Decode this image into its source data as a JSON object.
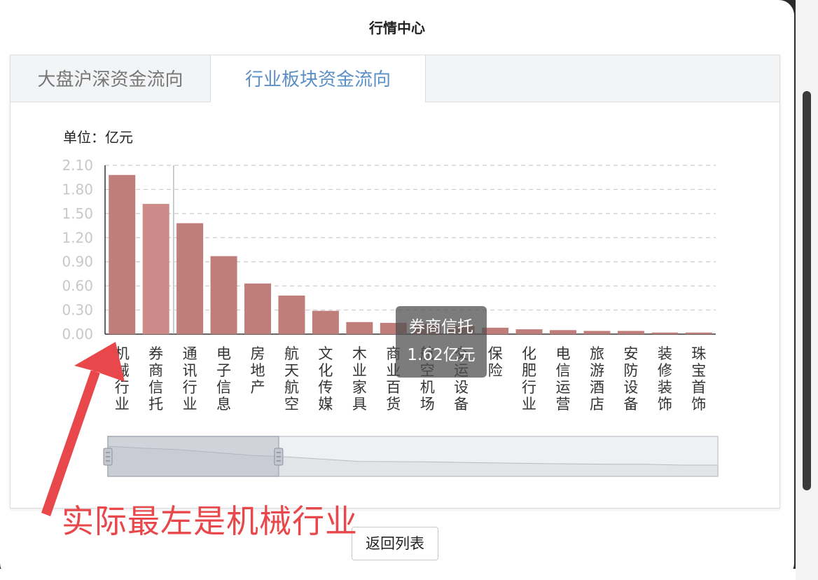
{
  "window": {
    "title": "行情中心"
  },
  "tabs": [
    {
      "label": "大盘沪深资金流向",
      "active": false
    },
    {
      "label": "行业板块资金流向",
      "active": true
    }
  ],
  "unit_label": "单位：亿元",
  "chart_data": {
    "type": "bar",
    "categories": [
      "机械行业",
      "券商信托",
      "通讯行业",
      "电子信息",
      "房地产",
      "航天航空",
      "文化传媒",
      "木业家具",
      "商业百货",
      "航空机场",
      "交运设备",
      "保险",
      "化肥行业",
      "电信运营",
      "旅游酒店",
      "安防设备",
      "装修装饰",
      "珠宝首饰"
    ],
    "values": [
      1.98,
      1.62,
      1.38,
      0.97,
      0.63,
      0.48,
      0.29,
      0.15,
      0.14,
      0.13,
      0.1,
      0.08,
      0.06,
      0.05,
      0.04,
      0.04,
      0.02,
      0.02
    ],
    "yticks": [
      "0.00",
      "0.30",
      "0.60",
      "0.90",
      "1.20",
      "1.50",
      "1.80",
      "2.10"
    ],
    "ylim": [
      0,
      2.1
    ],
    "highlight_index": 1,
    "grid": true,
    "colors": {
      "bar": "#c07e7b",
      "bar_highlight": "#cc8a88",
      "axis": "#333333",
      "grid": "#cccccc",
      "tick_text": "#c8c8c8"
    }
  },
  "tooltip": {
    "name": "券商信托",
    "value": "1.62亿元"
  },
  "minimap": {
    "window_start": 0,
    "window_end": 0.28
  },
  "back_button": "返回列表",
  "annotation": {
    "text": "实际最左是机械行业",
    "color": "#e8474b"
  }
}
